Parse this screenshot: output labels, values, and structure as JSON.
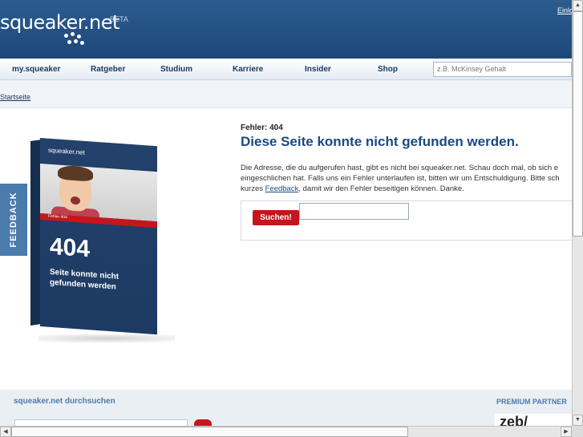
{
  "header": {
    "logo_text": "squeaker.net",
    "beta": "BETA",
    "top_link": "Einlo"
  },
  "nav": {
    "items": [
      "my.squeaker",
      "Ratgeber",
      "Studium",
      "Karriere",
      "Insider",
      "Shop"
    ],
    "search_placeholder": "z.B. McKinsey Gehalt"
  },
  "breadcrumb": "Startseite",
  "box": {
    "brand": "squeaker.net",
    "red_label": "Fehler 404",
    "code": "404",
    "text": "Seite konnte nicht gefunden werden"
  },
  "feedback_tab": "FEEDBACK",
  "main": {
    "error_label": "Fehler: 404",
    "title": "Diese Seite konnte nicht gefunden werden.",
    "text_line1": "Die Adresse, die du aufgerufen hast, gibt es nicht bei squeaker.net. Schau doch mal, ob sich e",
    "text_line2": "eingeschlichen hat. Falls uns ein Fehler unterlaufen ist, bitten wir um Entschuldigung. Bitte sch",
    "text_line3_pre": "kurzes ",
    "text_line3_link": "Feedback",
    "text_line3_post": ", damit wir den Fehler beseitigen können. Danke.",
    "search_button": "Suchen!"
  },
  "footer": {
    "search_title": "squeaker.net durchsuchen",
    "partner_title": "PREMIUM PARTNER",
    "partner_logo": "zeb/"
  },
  "colors": {
    "header_blue": "#1d4778",
    "accent_red": "#c4161c",
    "link_blue": "#1a4a80"
  }
}
